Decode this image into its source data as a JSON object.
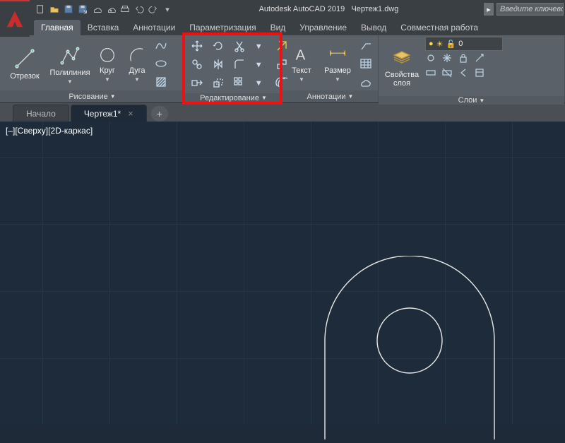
{
  "title": {
    "app": "Autodesk AutoCAD 2019",
    "doc": "Чертеж1.dwg"
  },
  "searchPlaceholder": "Введите ключевое сло",
  "ribbonTabs": [
    "Главная",
    "Вставка",
    "Аннотации",
    "Параметризация",
    "Вид",
    "Управление",
    "Вывод",
    "Совместная работа"
  ],
  "activeRibbonTab": 0,
  "panels": {
    "draw": {
      "title": "Рисование",
      "tools": {
        "line": "Отрезок",
        "polyline": "Полилиния",
        "circle": "Круг",
        "arc": "Дуга"
      }
    },
    "modify": {
      "title": "Редактирование"
    },
    "annot": {
      "title": "Аннотации",
      "tools": {
        "text": "Текст",
        "dim": "Размер"
      }
    },
    "layerProps": "Свойства\nслоя",
    "layers": {
      "title": "Слои",
      "current": "0"
    }
  },
  "docTabs": [
    {
      "label": "Начало",
      "active": false
    },
    {
      "label": "Чертеж1*",
      "active": true
    }
  ],
  "viewportLabel": "[–][Сверху][2D-каркас]"
}
